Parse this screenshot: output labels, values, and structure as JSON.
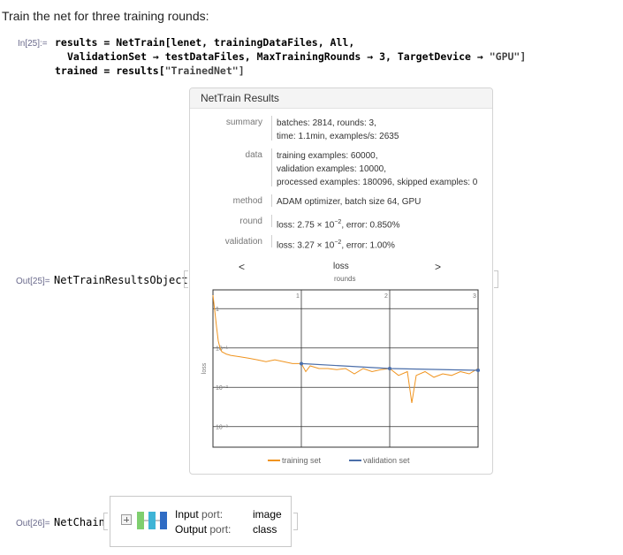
{
  "intro_text": "Train the net for three training rounds:",
  "input_cell": {
    "label": "In[25]:=",
    "lines": [
      "results = NetTrain[lenet, trainingDataFiles, All,",
      "ValidationSet → testDataFiles, MaxTrainingRounds → 3, TargetDevice → ",
      "trained = results[",
      "\"GPU\"]",
      "\"TrainedNet\"]"
    ]
  },
  "output_cell_25": {
    "label": "Out[25]=",
    "head": "NetTrainResultsObject"
  },
  "results_panel": {
    "title": "NetTrain Results",
    "rows": [
      {
        "label": "summary",
        "lines": [
          "batches: 2814, rounds: 3,",
          "time: 1.1min, examples/s: 2635"
        ]
      },
      {
        "label": "data",
        "lines": [
          "training examples: 60000,",
          "validation examples: 10000,",
          "processed examples: 180096, skipped examples: 0"
        ]
      },
      {
        "label": "method",
        "lines": [
          "ADAM optimizer, batch size 64, GPU"
        ]
      },
      {
        "label": "round",
        "pre": "loss: 2.75 × 10",
        "exp": "−2",
        "post": ", error: 0.850%"
      },
      {
        "label": "validation",
        "pre": "loss: 3.27 × 10",
        "exp": "−2",
        "post": ", error: 1.00%"
      }
    ],
    "chart_nav": {
      "prev": "<",
      "next": ">"
    },
    "chart_data": {
      "type": "line",
      "title": "loss",
      "subtitle": "rounds",
      "ylabel": "loss",
      "ylog": true,
      "xlim": [
        0,
        3
      ],
      "ylim": [
        0.0003,
        3
      ],
      "grid": true,
      "x_ticks": [
        "1",
        "2",
        "3"
      ],
      "y_ticks": [
        {
          "label": "1",
          "value": 1
        },
        {
          "label": "10⁻¹",
          "value": 0.1
        },
        {
          "label": "10⁻²",
          "value": 0.01
        },
        {
          "label": "10⁻³",
          "value": 0.001
        }
      ],
      "legend_position": "bottom",
      "series": [
        {
          "name": "training set",
          "color": "#f0941f",
          "x": [
            0.0,
            0.02,
            0.04,
            0.06,
            0.08,
            0.1,
            0.15,
            0.2,
            0.3,
            0.4,
            0.5,
            0.6,
            0.7,
            0.8,
            0.9,
            1.0,
            1.05,
            1.1,
            1.2,
            1.3,
            1.4,
            1.5,
            1.6,
            1.7,
            1.8,
            1.9,
            2.0,
            2.1,
            2.2,
            2.25,
            2.3,
            2.4,
            2.5,
            2.6,
            2.7,
            2.8,
            2.9,
            3.0
          ],
          "y": [
            2.2,
            0.9,
            0.35,
            0.15,
            0.1,
            0.08,
            0.07,
            0.065,
            0.06,
            0.055,
            0.05,
            0.045,
            0.05,
            0.045,
            0.04,
            0.04,
            0.025,
            0.035,
            0.03,
            0.03,
            0.028,
            0.03,
            0.022,
            0.03,
            0.025,
            0.028,
            0.03,
            0.02,
            0.025,
            0.004,
            0.02,
            0.025,
            0.018,
            0.022,
            0.02,
            0.025,
            0.022,
            0.03
          ]
        },
        {
          "name": "validation set",
          "color": "#4b6ea9",
          "x": [
            1,
            2,
            3
          ],
          "y": [
            0.04,
            0.03,
            0.027
          ]
        }
      ]
    }
  },
  "output_cell_26": {
    "label": "Out[26]=",
    "head": "NetChain",
    "ports": [
      {
        "key": "Input",
        "suffix": " port:",
        "value": "image"
      },
      {
        "key": "Output",
        "suffix": " port:",
        "value": "class"
      }
    ],
    "layer_colors": [
      "#7fcf6f",
      "#3fb4d6",
      "#2f6cc4"
    ]
  }
}
